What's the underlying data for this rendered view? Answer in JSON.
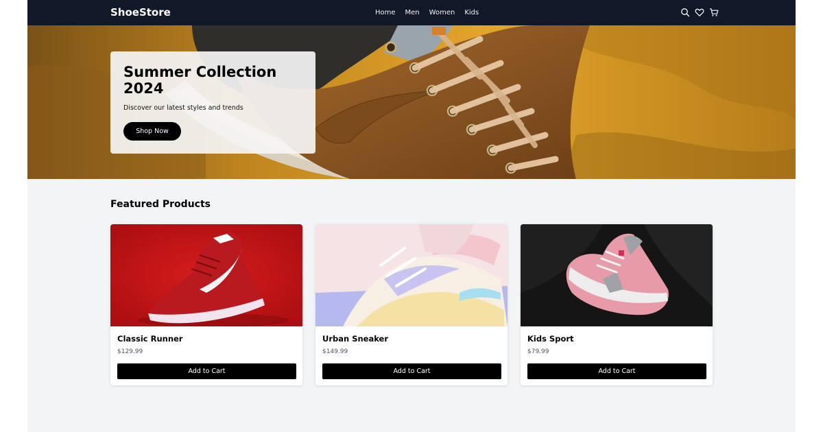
{
  "brand": {
    "name": "ShoeStore"
  },
  "nav": {
    "links": [
      {
        "label": "Home"
      },
      {
        "label": "Men"
      },
      {
        "label": "Women"
      },
      {
        "label": "Kids"
      }
    ],
    "icons": [
      "search-icon",
      "heart-icon",
      "cart-icon"
    ]
  },
  "hero": {
    "title": "Summer Collection 2024",
    "subtitle": "Discover our latest styles and trends",
    "cta": "Shop Now"
  },
  "featured": {
    "title": "Featured Products",
    "products": [
      {
        "name": "Classic Runner",
        "price": "$129.99",
        "button": "Add to Cart"
      },
      {
        "name": "Urban Sneaker",
        "price": "$149.99",
        "button": "Add to Cart"
      },
      {
        "name": "Kids Sport",
        "price": "$79.99",
        "button": "Add to Cart"
      }
    ]
  },
  "colors": {
    "nav_bg": "#111827",
    "page_bg": "#f3f4f6",
    "button_bg": "#000000",
    "hero_tone": "#d89a24"
  }
}
